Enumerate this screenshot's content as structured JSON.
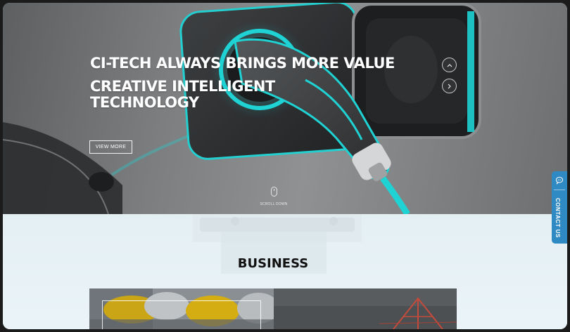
{
  "hero": {
    "title_line1": "CI-TECH ALWAYS BRINGS MORE VALUE",
    "title_line2": "CREATIVE INTELLIGENT TECHNOLOGY",
    "view_more_label": "VIEW MORE",
    "scroll_label": "SCROLL DOWN",
    "prev_icon": "chevron-up-icon",
    "next_icon": "chevron-right-icon",
    "accent_color": "#1fd3d4"
  },
  "business": {
    "title": "BUSINESS"
  },
  "contact": {
    "label": "CONTACT US",
    "icon": "chat-bubble-icon",
    "color": "#2f89c2"
  }
}
